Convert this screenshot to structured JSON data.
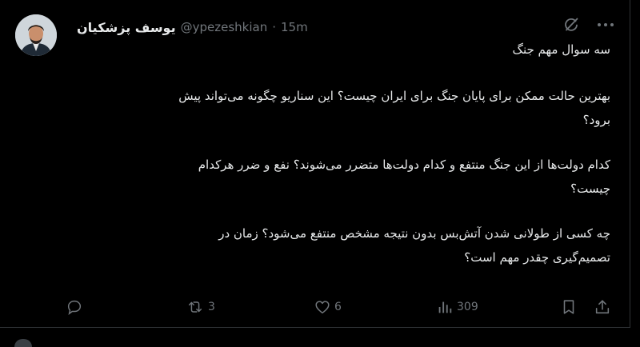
{
  "author": {
    "display_name": "یوسف پزشکیان",
    "handle": "@ypezeshkian",
    "separator": "·",
    "time": "15m"
  },
  "tweet": {
    "lines": [
      "سه سوال مهم جنگ",
      "",
      "بهترین حالت ممکن برای پایان جنگ برای ایران چیست؟ این سناریو چگونه می‌تواند پیش",
      "برود؟",
      "",
      "کدام دولت‌ها از این جنگ منتفع و کدام دولت‌ها متضرر می‌شوند؟ نفع و ضرر هرکدام",
      "چیست؟",
      "",
      "چه کسی از طولانی شدن آتش‌بس بدون نتیجه مشخص منتفع می‌شود؟ زمان در",
      "تصمیم‌گیری چقدر مهم است؟"
    ]
  },
  "actions": {
    "reply": "",
    "retweet": "3",
    "like": "6",
    "views": "309"
  },
  "icons": {
    "grok": "grok-icon",
    "more": "more-icon",
    "reply": "reply-icon",
    "retweet": "retweet-icon",
    "like": "heart-icon",
    "views": "views-icon",
    "bookmark": "bookmark-icon",
    "share": "share-icon"
  },
  "colors": {
    "background": "#000000",
    "text": "#e7e9ea",
    "muted": "#71767b",
    "border": "#2f3336"
  }
}
